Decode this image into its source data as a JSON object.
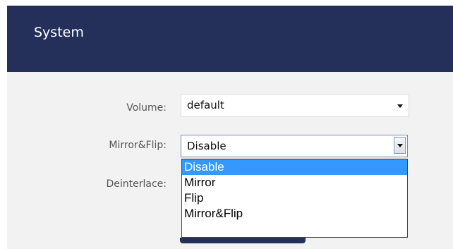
{
  "header": {
    "title": "System"
  },
  "form": {
    "volume": {
      "label": "Volume:",
      "value": "default"
    },
    "mirror_flip": {
      "label": "Mirror&Flip:",
      "value": "Disable",
      "options": [
        "Disable",
        "Mirror",
        "Flip",
        "Mirror&Flip"
      ],
      "highlighted_option": "Disable"
    },
    "deinterlace": {
      "label": "Deinterlace:"
    }
  },
  "colors": {
    "header_bg": "#24305a",
    "panel_bg": "#f2f2f2",
    "selection": "#3399ff"
  }
}
